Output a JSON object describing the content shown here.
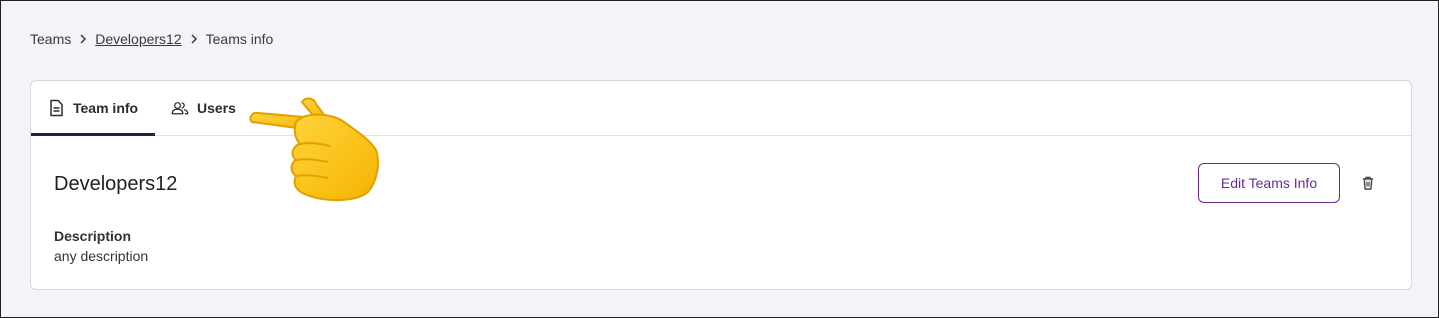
{
  "breadcrumb": {
    "items": [
      "Teams",
      "Developers12",
      "Teams info"
    ]
  },
  "tabs": [
    {
      "label": "Team info",
      "icon": "document-icon",
      "active": true
    },
    {
      "label": "Users",
      "icon": "users-icon",
      "active": false
    }
  ],
  "team": {
    "name": "Developers12",
    "edit_label": "Edit Teams Info",
    "description_label": "Description",
    "description_value": "any description"
  },
  "colors": {
    "accent": "#6b2c91",
    "active_tab_underline": "#2d1f3d",
    "background": "#f4f3f7"
  },
  "overlay": {
    "icon": "pointing-hand-icon"
  }
}
